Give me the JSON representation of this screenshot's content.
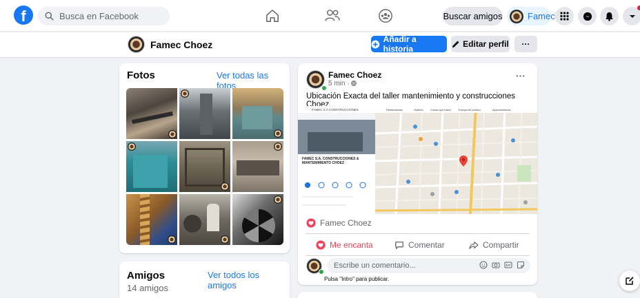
{
  "header": {
    "logo_letter": "f",
    "search_placeholder": "Busca en Facebook",
    "find_friends": "Buscar amigos",
    "profile_short": "Famec"
  },
  "profile_bar": {
    "name": "Famec Choez",
    "add_story": "Añadir a historia",
    "edit_profile": "Editar perfil",
    "more": "···"
  },
  "photos": {
    "title": "Fotos",
    "see_all": "Ver todas las fotos"
  },
  "friends": {
    "title": "Amigos",
    "see_all": "Ver todos los amigos",
    "count": "14 amigos"
  },
  "post": {
    "author": "Famec Choez",
    "time": "5 min · ",
    "text": "Ubicación Exacta del taller mantenimiento y construcciones Choez.",
    "reaction_name": "Famec Choez",
    "like": "Me encanta",
    "comment": "Comentar",
    "share": "Compartir",
    "comment_placeholder": "Escribe un comentario...",
    "press_enter": "Pulsa \"Intro\" para publicar.",
    "map_panel_title": "FAMEC S.A. CONSTRUCCIONES & MANTENIMIENTO CHOEZ",
    "map_search_text": "FAMEC S.A CONSTRUCCIONES",
    "map_chip_1": "Restaurantes",
    "map_chip_2": "Hoteles",
    "map_chip_3": "Cosas que hacer",
    "map_chip_4": "Transporte público",
    "map_chip_5": "Aparcamientos"
  },
  "colors": {
    "brand": "#1877f2",
    "love": "#f33e58"
  }
}
